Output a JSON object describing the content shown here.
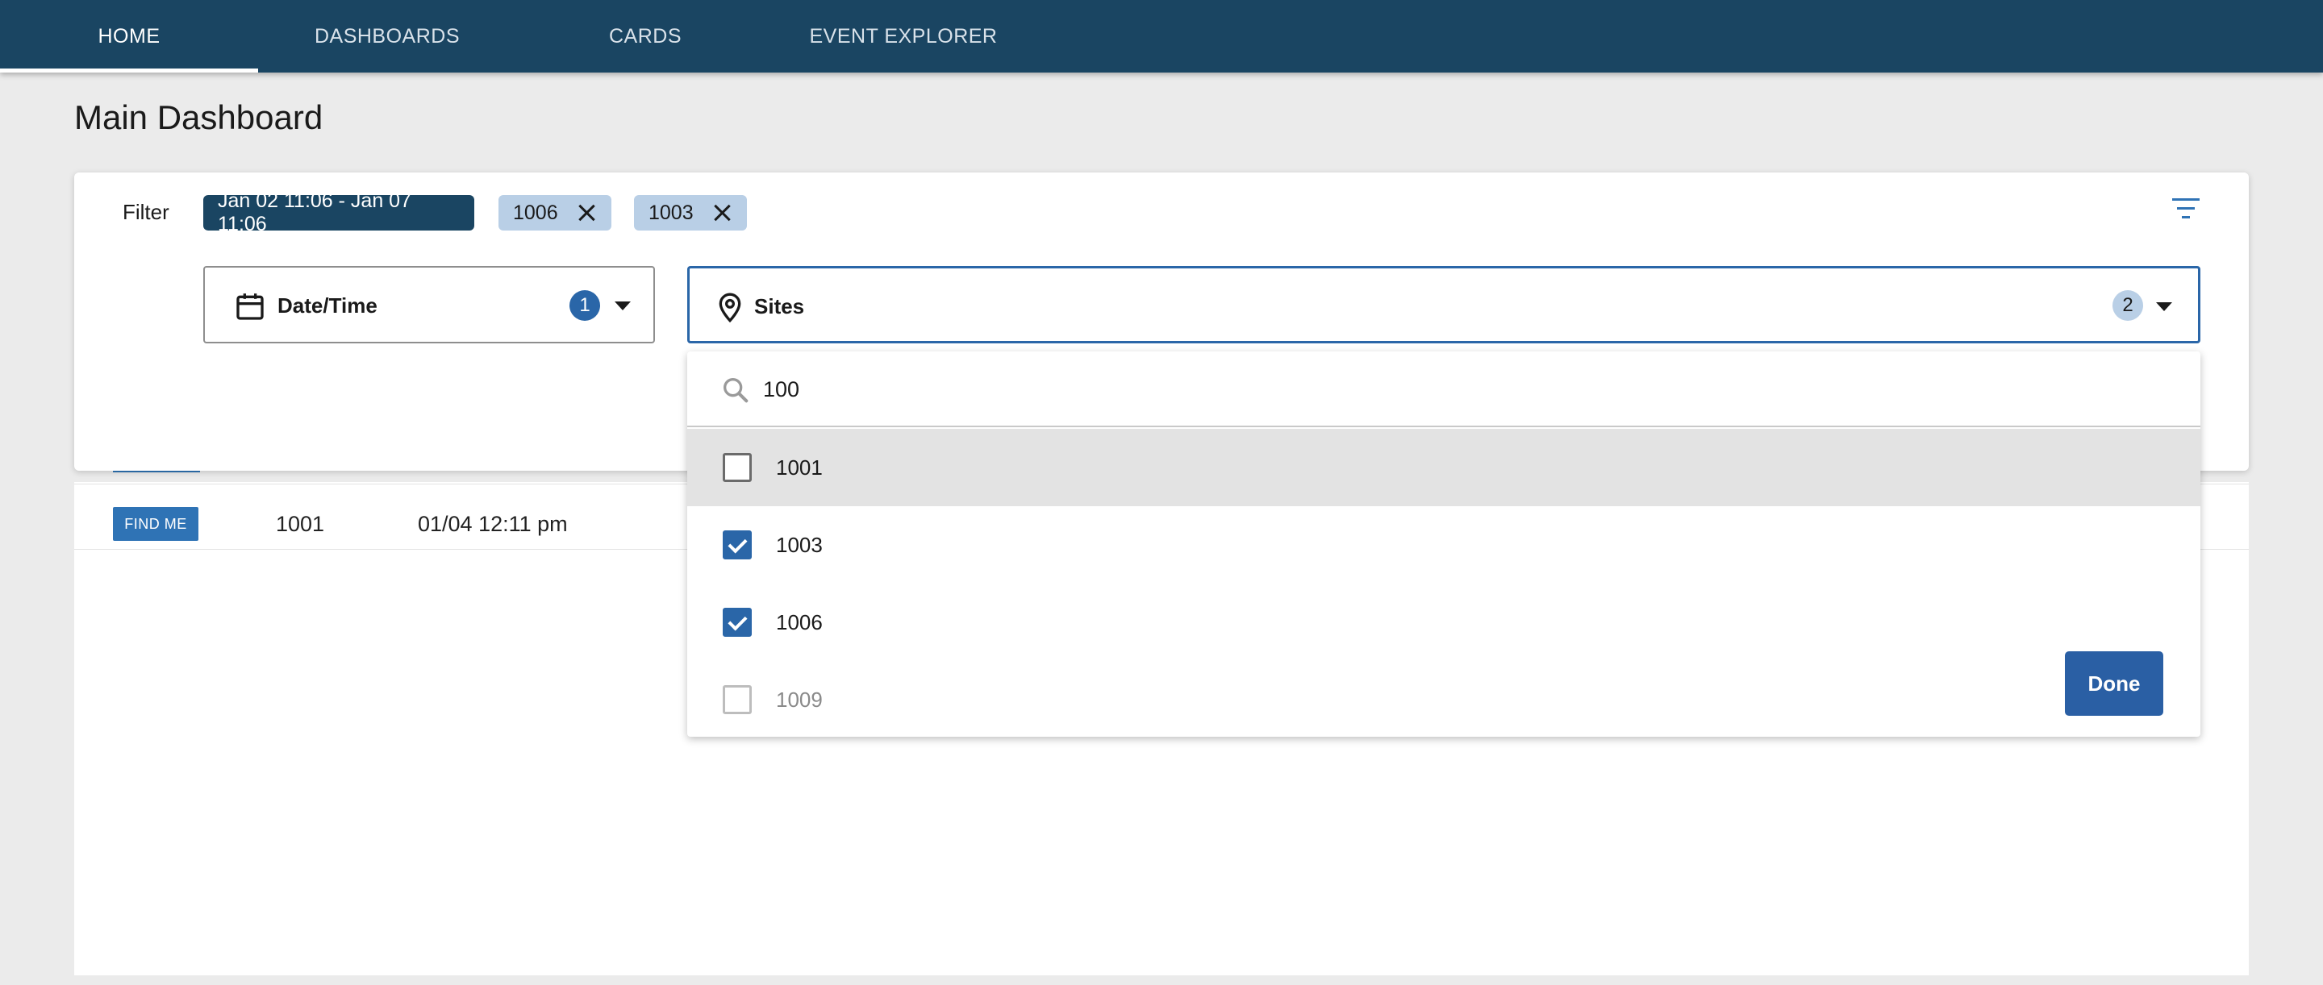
{
  "nav": {
    "tabs": [
      {
        "label": "HOME",
        "active": true
      },
      {
        "label": "DASHBOARDS",
        "active": false
      },
      {
        "label": "CARDS",
        "active": false
      },
      {
        "label": "EVENT EXPLORER",
        "active": false
      }
    ]
  },
  "page": {
    "title": "Main Dashboard"
  },
  "filter": {
    "label": "Filter",
    "chips": {
      "date_range": "Jan 02 11:06 - Jan 07 11:06",
      "site_a": "1006",
      "site_b": "1003"
    },
    "date_select": {
      "label": "Date/Time",
      "count": "1",
      "icon": "calendar-icon"
    },
    "sites_select": {
      "label": "Sites",
      "count": "2",
      "icon": "map-pin-icon"
    }
  },
  "dropdown": {
    "search_value": "100",
    "search_icon": "search-icon",
    "options": [
      {
        "label": "1001",
        "checked": false
      },
      {
        "label": "1003",
        "checked": true
      },
      {
        "label": "1006",
        "checked": true
      },
      {
        "label": "1009",
        "checked": false
      }
    ],
    "done_label": "Done"
  },
  "results": {
    "rows": [
      {
        "action": "FIND ME",
        "site": "1001",
        "time": "01/04 12:11 pm"
      }
    ]
  },
  "colors": {
    "nav_bg": "#1a4562",
    "accent": "#2a66a8",
    "chip_light": "#b9cfe6"
  }
}
